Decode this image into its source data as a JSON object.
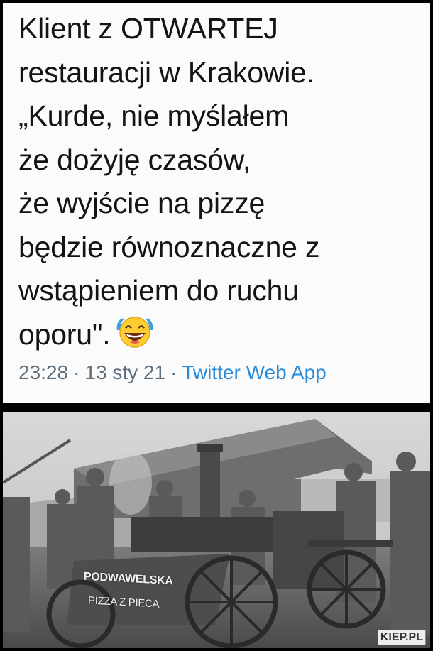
{
  "tweet": {
    "lines": [
      "Klient z OTWARTEJ",
      "restauracji w Krakowie.",
      "„Kurde, nie myślałem",
      "że dożyję czasów,",
      "że wyjście na pizzę",
      "będzie równoznaczne z",
      "wstąpieniem do ruchu",
      "oporu\"."
    ],
    "emoji": "laughing-with-tears-emoji",
    "time": "23:28",
    "date": "13 sty 21",
    "separator": "·",
    "source": "Twitter Web App",
    "source_color": "#2a8bd8"
  },
  "photo": {
    "sign_line_1": "PODWAWELSKA",
    "sign_line_2": "PIZZA Z PIECA",
    "watermark": "KIEP.PL"
  }
}
